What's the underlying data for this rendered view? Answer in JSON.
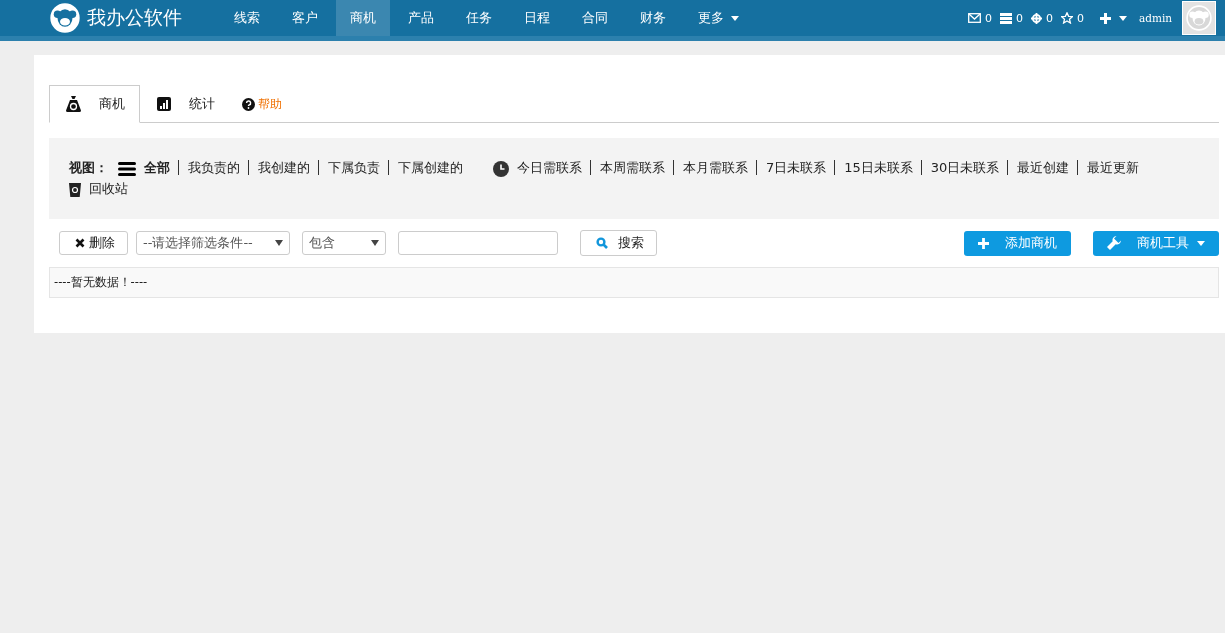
{
  "header": {
    "brand": "我办公软件",
    "nav": [
      {
        "label": "线索",
        "selected": false,
        "dropdown": false
      },
      {
        "label": "客户",
        "selected": false,
        "dropdown": false
      },
      {
        "label": "商机",
        "selected": true,
        "dropdown": false
      },
      {
        "label": "产品",
        "selected": false,
        "dropdown": false
      },
      {
        "label": "任务",
        "selected": false,
        "dropdown": false
      },
      {
        "label": "日程",
        "selected": false,
        "dropdown": false
      },
      {
        "label": "合同",
        "selected": false,
        "dropdown": false
      },
      {
        "label": "财务",
        "selected": false,
        "dropdown": false
      },
      {
        "label": "更多",
        "selected": false,
        "dropdown": true
      }
    ],
    "counters": [
      {
        "kind": "mail",
        "count": "0"
      },
      {
        "kind": "list",
        "count": "0"
      },
      {
        "kind": "target",
        "count": "0"
      },
      {
        "kind": "star",
        "count": "0"
      }
    ],
    "user": "admin"
  },
  "tabs": [
    {
      "label": "商机",
      "kind": "money",
      "selected": true
    },
    {
      "label": "统计",
      "kind": "chart",
      "selected": false
    }
  ],
  "help": "帮助",
  "views": {
    "label": "视图：",
    "groups": [
      {
        "kind": "list",
        "items": [
          {
            "label": "全部",
            "selected": true
          },
          {
            "label": "我负责的",
            "selected": false
          },
          {
            "label": "我创建的",
            "selected": false
          },
          {
            "label": "下属负责",
            "selected": false
          },
          {
            "label": "下属创建的",
            "selected": false
          }
        ]
      },
      {
        "kind": "clock",
        "items": [
          {
            "label": "今日需联系",
            "selected": false
          },
          {
            "label": "本周需联系",
            "selected": false
          },
          {
            "label": "本月需联系",
            "selected": false
          },
          {
            "label": "7日未联系",
            "selected": false
          },
          {
            "label": "15日未联系",
            "selected": false
          },
          {
            "label": "30日未联系",
            "selected": false
          },
          {
            "label": "最近创建",
            "selected": false
          },
          {
            "label": "最近更新",
            "selected": false
          }
        ]
      },
      {
        "kind": "trash",
        "items": [
          {
            "label": "回收站",
            "selected": false
          }
        ]
      }
    ]
  },
  "toolbar": {
    "delete": "删除",
    "filter_select": "--请选择筛选条件--",
    "operator_select": "包含",
    "search": "搜索",
    "add": "添加商机",
    "tools": "商机工具"
  },
  "empty_message": "----暂无数据！----"
}
